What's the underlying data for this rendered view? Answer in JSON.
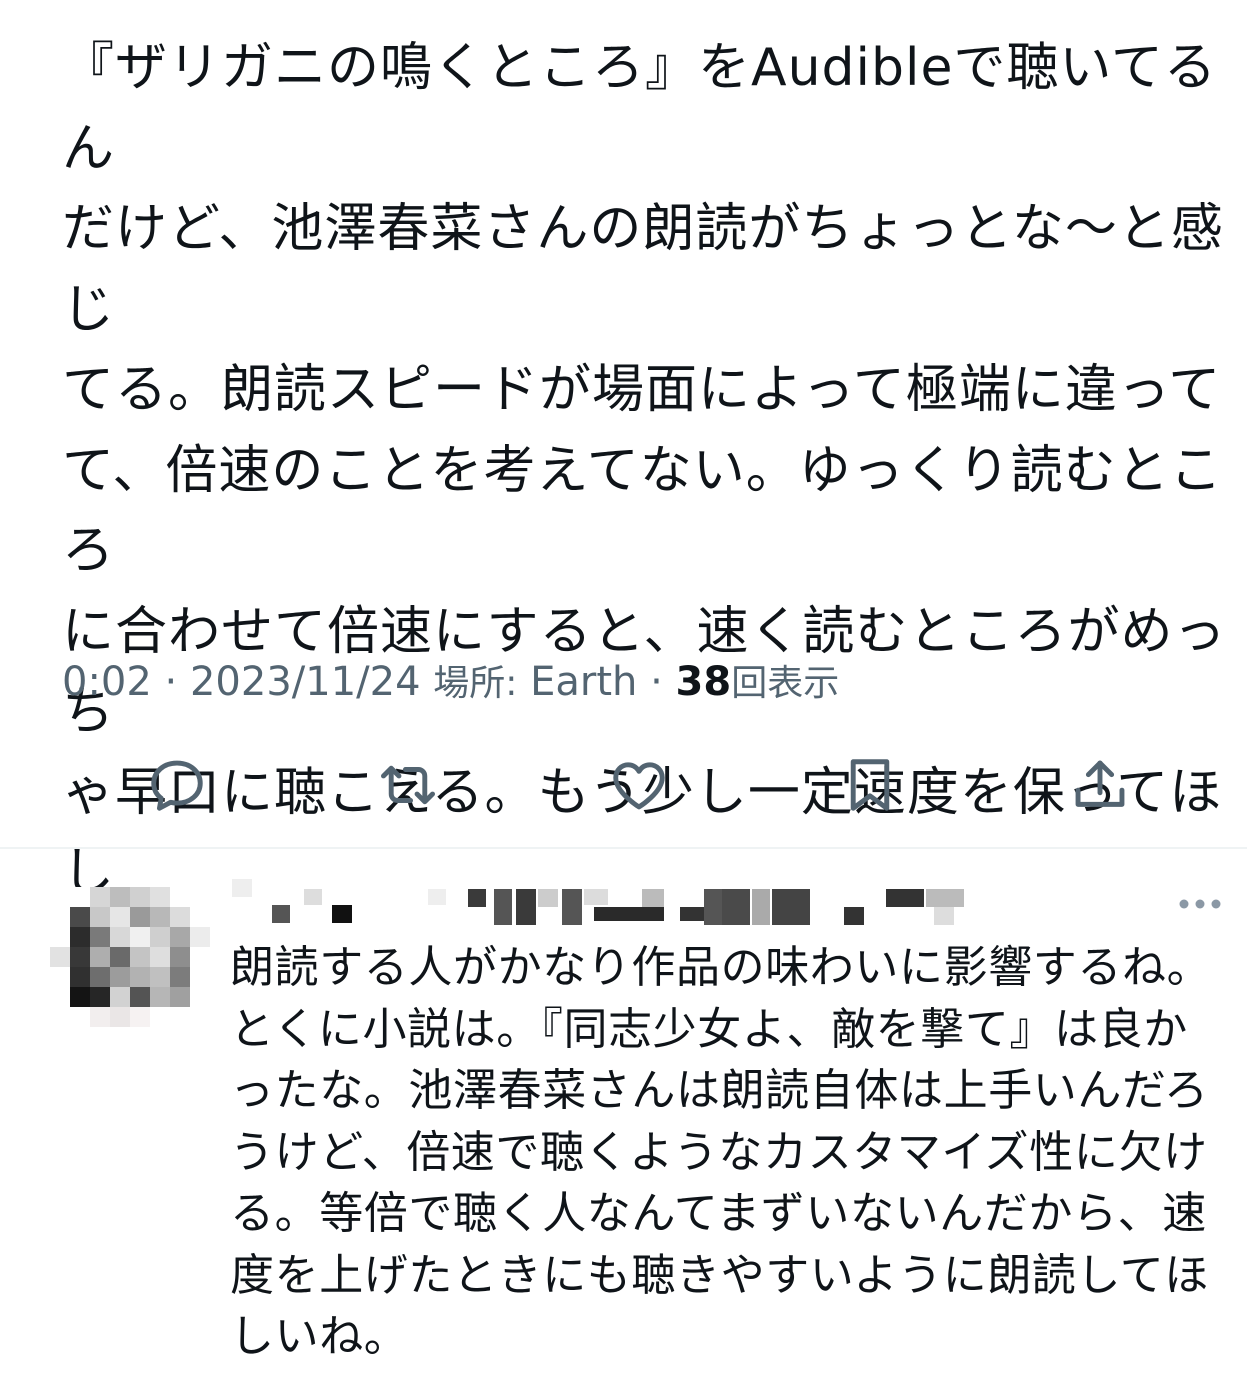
{
  "tweet": {
    "text": "『ザリガニの鳴くところ』をAudibleで聴いてるん\nだけど、池澤春菜さんの朗読がちょっとな〜と感じ\nてる。朗読スピードが場面によって極端に違って\nて、倍速のことを考えてない。ゆっくり読むところ\nに合わせて倍速にすると、速く読むところがめっち\nゃ早口に聴こえる。もう少し一定速度を保ってほし\nい。",
    "time": "0:02",
    "separator": "·",
    "date": "2023/11/24",
    "location_label": "場所:",
    "location": "Earth",
    "views_count": "38",
    "views_label": "回表示"
  },
  "actions": [
    {
      "icon": "reply-icon"
    },
    {
      "icon": "retweet-icon"
    },
    {
      "icon": "like-icon"
    },
    {
      "icon": "bookmark-icon"
    },
    {
      "icon": "share-icon"
    }
  ],
  "reply": {
    "text": "朗読する人がかなり作品の味わいに影響するね。\nとくに小説は。『同志少女よ、敵を撃て』は良か\nったな。池澤春菜さんは朗読自体は上手いんだろ\nうけど、倍速で聴くようなカスタマイズ性に欠け\nる。等倍で聴く人なんてまずいないんだから、速\n度を上げたときにも聴きやすいように朗読してほ\nしいね。",
    "more_icon": "more-icon",
    "avatar_icon": "pixelated-avatar"
  },
  "colors": {
    "text": "#0f1419",
    "secondary": "#536471",
    "divider": "#eff3f4"
  }
}
